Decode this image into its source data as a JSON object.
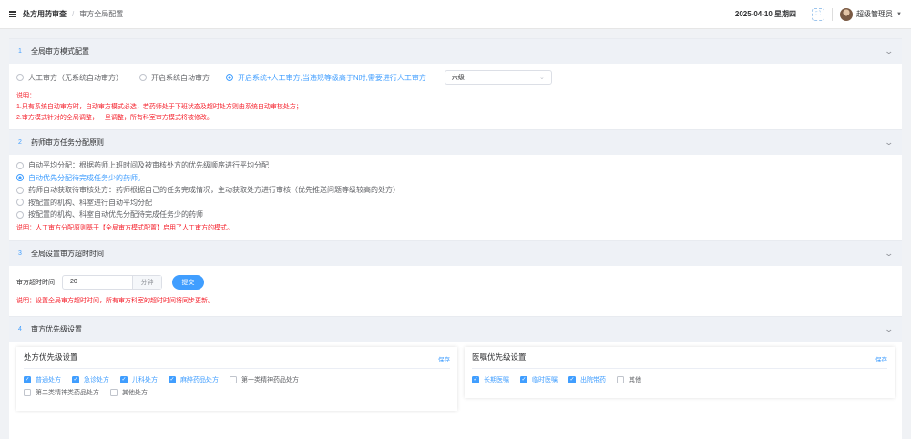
{
  "header": {
    "breadcrumb_main": "处方用药审查",
    "breadcrumb_sep": "/",
    "breadcrumb_sub": "审方全局配置",
    "datetime": "2025-04-10 星期四",
    "username": "超级管理员"
  },
  "section1": {
    "num": "1",
    "title": "全局审方模式配置",
    "options": [
      {
        "label": "人工审方（无系统自动审方）",
        "checked": false
      },
      {
        "label": "开启系统自动审方",
        "checked": false
      },
      {
        "label": "开启系统+人工审方,当违规等级高于N时,需要进行人工审方",
        "checked": true
      }
    ],
    "level_select": "六级",
    "notes": [
      "说明：",
      "1.只有系统自动审方时，自动审方模式必选，若药师处于下班状态及超时处方则由系统自动审核处方；",
      "2.审方模式针对的全局调整，一旦调整，所有科室审方模式将被修改。"
    ]
  },
  "section2": {
    "num": "2",
    "title": "药师审方任务分配原则",
    "options": [
      {
        "label": "自动平均分配：根据药师上班时间及被审核处方的优先级顺序进行平均分配",
        "checked": false
      },
      {
        "label": "自动优先分配待完成任务少的药师。",
        "checked": true
      },
      {
        "label": "药师自动获取待审核处方：药师根据自己的任务完成情况，主动获取处方进行审核（优先推送问题等级较高的处方）",
        "checked": false
      },
      {
        "label": "按配置的机构、科室进行自动平均分配",
        "checked": false
      },
      {
        "label": "按配置的机构、科室自动优先分配待完成任务少的药师",
        "checked": false
      }
    ],
    "note": "说明：人工审方分配原则基于【全局审方模式配置】启用了人工审方的模式。"
  },
  "section3": {
    "num": "3",
    "title": "全局设置审方超时时间",
    "timeout_label": "审方超时时间",
    "timeout_value": "20",
    "timeout_unit": "分钟",
    "submit_label": "提交",
    "note": "说明：设置全局审方超时时间，所有审方科室的超时时间将同步更新。"
  },
  "section4": {
    "num": "4",
    "title": "审方优先级设置",
    "rx_card": {
      "title": "处方优先级设置",
      "save_label": "保存",
      "items": [
        {
          "label": "普通处方",
          "checked": true
        },
        {
          "label": "急诊处方",
          "checked": true
        },
        {
          "label": "儿科处方",
          "checked": true
        },
        {
          "label": "麻醉药品处方",
          "checked": true
        },
        {
          "label": "第一类精神药品处方",
          "checked": false
        },
        {
          "label": "第二类精神类药品处方",
          "checked": false
        },
        {
          "label": "其他处方",
          "checked": false
        }
      ]
    },
    "order_card": {
      "title": "医嘱优先级设置",
      "save_label": "保存",
      "items": [
        {
          "label": "长期医嘱",
          "checked": true
        },
        {
          "label": "临时医嘱",
          "checked": true
        },
        {
          "label": "出院带药",
          "checked": true
        },
        {
          "label": "其他",
          "checked": false
        }
      ]
    }
  },
  "colors": {
    "accent": "#409eff",
    "note_red": "#f5222d",
    "section_bg": "#eef1f6"
  }
}
